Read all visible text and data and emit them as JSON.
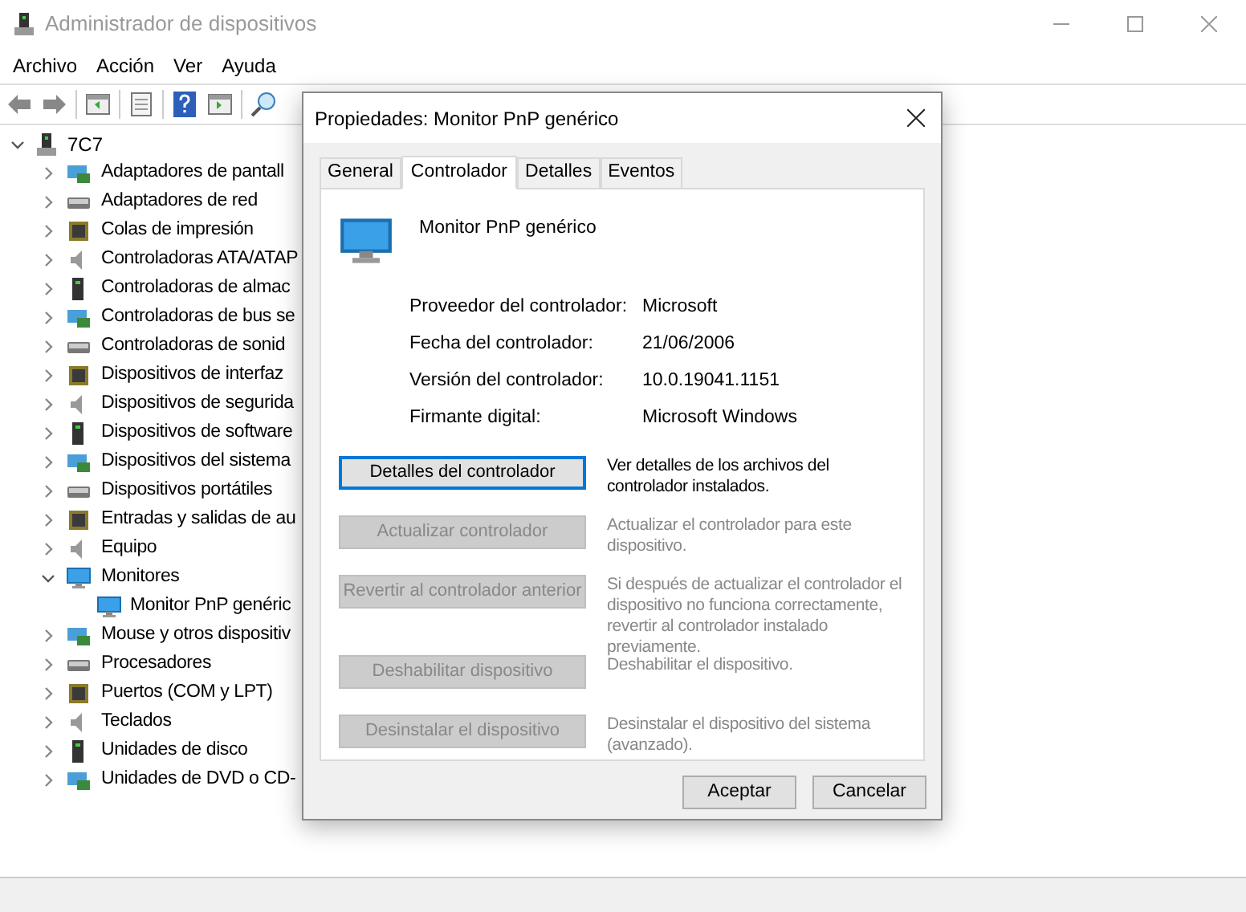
{
  "window": {
    "title": "Administrador de dispositivos"
  },
  "menu": [
    "Archivo",
    "Acción",
    "Ver",
    "Ayuda"
  ],
  "tree": {
    "label": "7C7",
    "expanded": true,
    "children": [
      {
        "label": "Adaptadores de pantall",
        "expanded": false
      },
      {
        "label": "Adaptadores de red",
        "expanded": false
      },
      {
        "label": "Colas de impresión",
        "expanded": false
      },
      {
        "label": "Controladoras ATA/ATAP",
        "expanded": false
      },
      {
        "label": "Controladoras de almac",
        "expanded": false
      },
      {
        "label": "Controladoras de bus se",
        "expanded": false
      },
      {
        "label": "Controladoras de sonid",
        "expanded": false
      },
      {
        "label": "Dispositivos de interfaz",
        "expanded": false
      },
      {
        "label": "Dispositivos de segurida",
        "expanded": false
      },
      {
        "label": "Dispositivos de software",
        "expanded": false
      },
      {
        "label": "Dispositivos del sistema",
        "expanded": false
      },
      {
        "label": "Dispositivos portátiles",
        "expanded": false
      },
      {
        "label": "Entradas y salidas de au",
        "expanded": false
      },
      {
        "label": "Equipo",
        "expanded": false
      },
      {
        "label": "Monitores",
        "expanded": true,
        "children": [
          {
            "label": "Monitor PnP genéric"
          }
        ]
      },
      {
        "label": "Mouse y otros dispositiv",
        "expanded": false
      },
      {
        "label": "Procesadores",
        "expanded": false
      },
      {
        "label": "Puertos (COM y LPT)",
        "expanded": false
      },
      {
        "label": "Teclados",
        "expanded": false
      },
      {
        "label": "Unidades de disco",
        "expanded": false
      },
      {
        "label": "Unidades de DVD o CD-",
        "expanded": false
      }
    ]
  },
  "dialog": {
    "title": "Propiedades: Monitor PnP genérico",
    "tabs": [
      {
        "label": "General",
        "selected": false
      },
      {
        "label": "Controlador",
        "selected": true
      },
      {
        "label": "Detalles",
        "selected": false
      },
      {
        "label": "Eventos",
        "selected": false
      }
    ],
    "device_name": "Monitor PnP genérico",
    "properties": [
      {
        "label": "Proveedor del controlador:",
        "value": "Microsoft"
      },
      {
        "label": "Fecha del controlador:",
        "value": "21/06/2006"
      },
      {
        "label": "Versión del controlador:",
        "value": "10.0.19041.1151"
      },
      {
        "label": "Firmante digital:",
        "value": "Microsoft Windows"
      }
    ],
    "actions": [
      {
        "button": "Detalles del controlador",
        "description": "Ver detalles de los archivos del controlador instalados.",
        "disabled": false,
        "focused": true
      },
      {
        "button": "Actualizar controlador",
        "description": "Actualizar el controlador para este dispositivo.",
        "disabled": true,
        "focused": false
      },
      {
        "button": "Revertir al controlador anterior",
        "description": "Si después de actualizar el controlador el dispositivo no funciona correctamente, revertir al controlador instalado previamente.",
        "disabled": true,
        "focused": false
      },
      {
        "button": "Deshabilitar dispositivo",
        "description": "Deshabilitar el dispositivo.",
        "disabled": true,
        "focused": false
      },
      {
        "button": "Desinstalar el dispositivo",
        "description": "Desinstalar el dispositivo del sistema (avanzado).",
        "disabled": true,
        "focused": false
      }
    ],
    "buttons": [
      "Aceptar",
      "Cancelar"
    ]
  }
}
